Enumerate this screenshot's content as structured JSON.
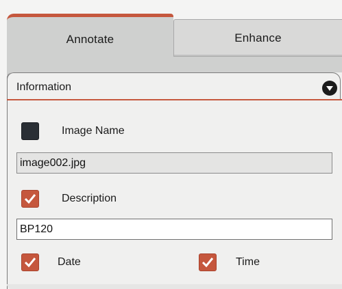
{
  "tabs": [
    {
      "label": "Annotate",
      "active": true
    },
    {
      "label": "Enhance",
      "active": false
    }
  ],
  "section": {
    "title": "Information",
    "collapse_icon": "chevron-down-circle-icon"
  },
  "image_name": {
    "label": "Image Name",
    "checked": false,
    "value": "image002.jpg",
    "editable": false
  },
  "description": {
    "label": "Description",
    "checked": true,
    "value": "BP120",
    "editable": true
  },
  "date": {
    "label": "Date",
    "checked": true
  },
  "time": {
    "label": "Time",
    "checked": true
  },
  "colors": {
    "accent": "#c5573d",
    "unchecked": "#2a2f35",
    "tab_active": "#cfd0cf",
    "tab_inactive": "#d9d9d8"
  }
}
